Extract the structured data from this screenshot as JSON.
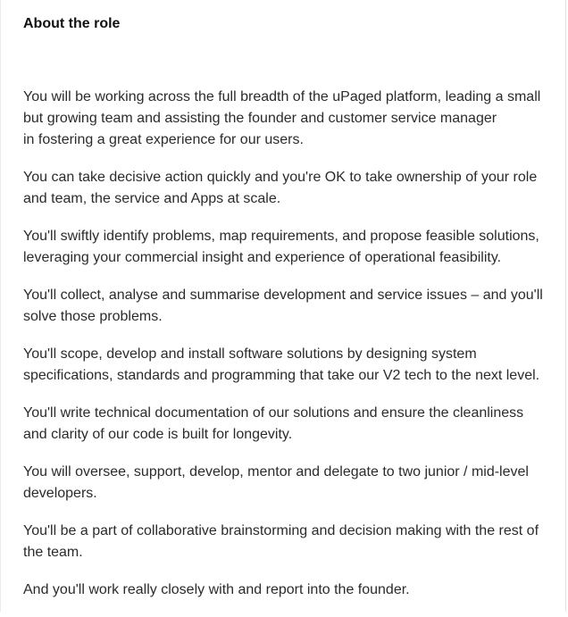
{
  "section": {
    "title": "About the role"
  },
  "paragraphs": [
    {
      "lines": [
        "You will be working across the full breadth of the uPaged platform, leading a small",
        "but growing team and assisting the founder and customer service manager",
        "in fostering a great experience for our users."
      ]
    },
    {
      "lines": [
        "You can take decisive action quickly and you're OK to take ownership of your role",
        "and team, the service and Apps at scale."
      ]
    },
    {
      "lines": [
        "You'll swiftly identify problems, map requirements, and propose feasible solutions,",
        "leveraging your commercial insight and experience of operational feasibility."
      ]
    },
    {
      "lines": [
        "You'll collect, analyse and summarise development and service issues – and you'll",
        "solve those problems."
      ]
    },
    {
      "lines": [
        "You'll scope, develop and install software solutions by designing system",
        "specifications, standards and programming that take our V2 tech to the next level."
      ]
    },
    {
      "lines": [
        "You'll write technical documentation of our solutions and ensure the cleanliness",
        "and clarity of our code is built for longevity."
      ]
    },
    {
      "lines": [
        "You will oversee, support, develop, mentor and delegate to two junior / mid-level",
        "developers."
      ]
    },
    {
      "lines": [
        "You'll be a part of collaborative brainstorming and decision making with the rest of",
        "the team."
      ]
    },
    {
      "lines": [
        "And you'll work really closely with and report into the founder."
      ]
    }
  ]
}
